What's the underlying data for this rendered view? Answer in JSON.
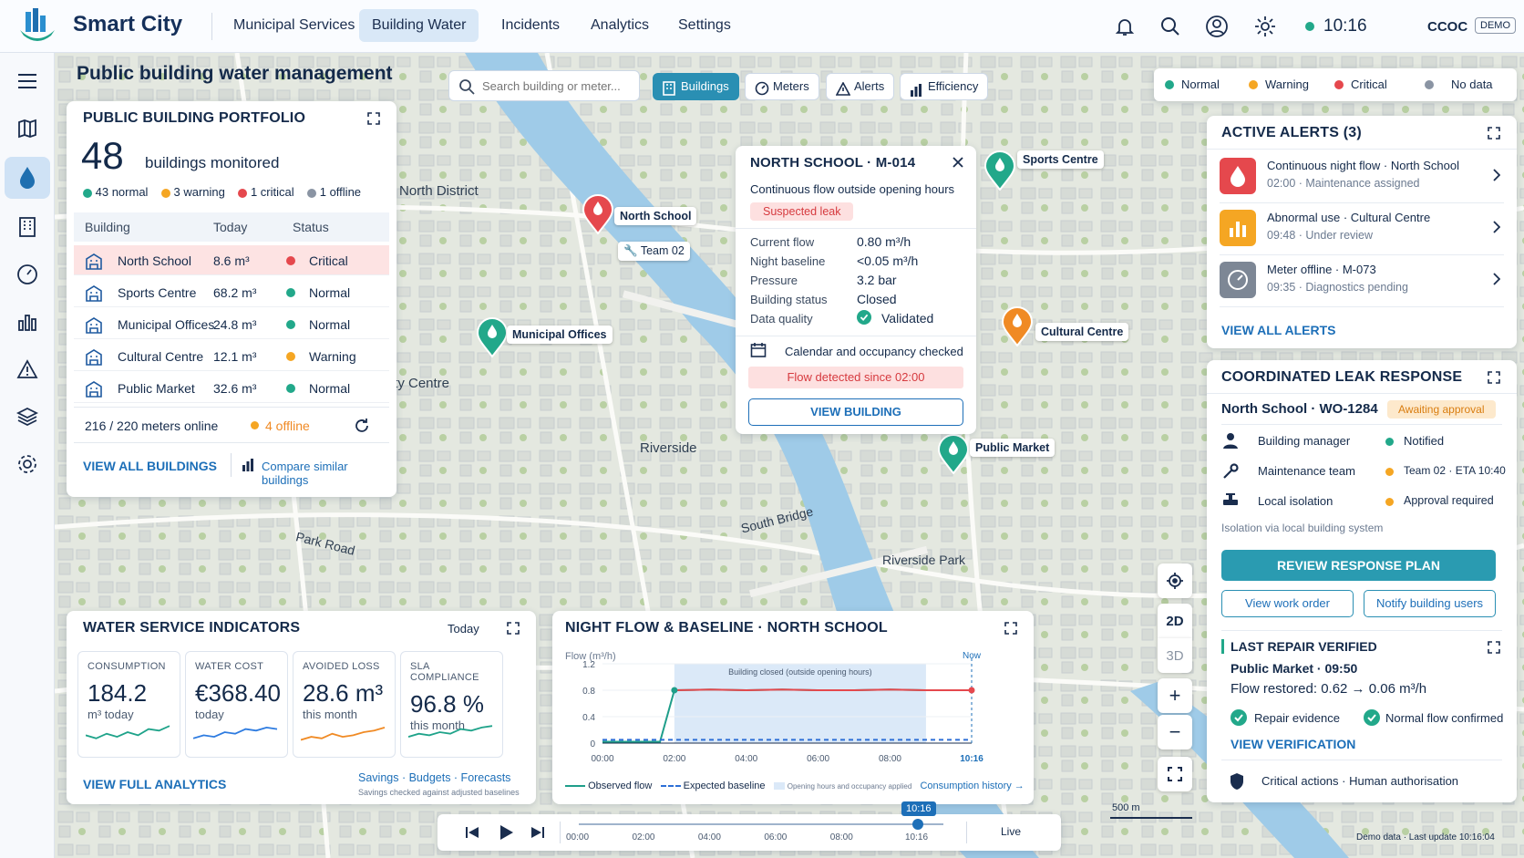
{
  "app": {
    "name": "Smart City",
    "user": "CCOC",
    "env": "DEMO",
    "time": "10:16"
  },
  "nav": [
    {
      "label": "Municipal Services"
    },
    {
      "label": "Building Water"
    },
    {
      "label": "Incidents"
    },
    {
      "label": "Analytics"
    },
    {
      "label": "Settings"
    }
  ],
  "page": {
    "title": "Public building water management"
  },
  "search": {
    "placeholder": "Search building or meter..."
  },
  "filters": [
    {
      "label": "Buildings"
    },
    {
      "label": "Meters"
    },
    {
      "label": "Alerts"
    },
    {
      "label": "Efficiency"
    }
  ],
  "legend": [
    {
      "label": "Normal",
      "color": "#22a88a"
    },
    {
      "label": "Warning",
      "color": "#f5a623"
    },
    {
      "label": "Critical",
      "color": "#e5484d"
    },
    {
      "label": "No data",
      "color": "#8a94a3"
    }
  ],
  "portfolio": {
    "title": "PUBLIC BUILDING PORTFOLIO",
    "count": "48",
    "count_label": "buildings monitored",
    "summary": [
      {
        "label": "43 normal",
        "color": "#22a88a"
      },
      {
        "label": "3 warning",
        "color": "#f5a623"
      },
      {
        "label": "1 critical",
        "color": "#e5484d"
      },
      {
        "label": "1 offline",
        "color": "#8a94a3"
      }
    ],
    "headers": [
      "Building",
      "Today",
      "Status"
    ],
    "rows": [
      {
        "name": "North School",
        "today": "8.6 m³",
        "status": "Critical",
        "color": "#e5484d",
        "icon": "school-icon"
      },
      {
        "name": "Sports Centre",
        "today": "68.2 m³",
        "status": "Normal",
        "color": "#22a88a",
        "icon": "pool-icon"
      },
      {
        "name": "Municipal Offices",
        "today": "24.8 m³",
        "status": "Normal",
        "color": "#22a88a",
        "icon": "office-icon"
      },
      {
        "name": "Cultural Centre",
        "today": "12.1 m³",
        "status": "Warning",
        "color": "#f5a623",
        "icon": "museum-icon"
      },
      {
        "name": "Public Market",
        "today": "32.6 m³",
        "status": "Normal",
        "color": "#22a88a",
        "icon": "market-icon"
      }
    ],
    "meters_online": "216 / 220 meters online",
    "offline": "4 offline",
    "view_all": "VIEW ALL BUILDINGS",
    "compare": "Compare similar buildings"
  },
  "map_labels": {
    "north_district": "North District",
    "city_centre": "City Centre",
    "riverside": "Riverside",
    "south_bridge": "South Bridge",
    "park_road": "Park Road",
    "riverside_park": "Riverside Park",
    "team": "Team 02",
    "scale": "500 m"
  },
  "pins": {
    "north_school": "North School",
    "municipal_offices": "Municipal Offices",
    "sports_centre": "Sports Centre",
    "cultural_centre": "Cultural Centre",
    "public_market": "Public Market"
  },
  "popup": {
    "title": "NORTH SCHOOL · M-014",
    "subtitle": "Continuous flow outside opening hours",
    "tag": "Suspected leak",
    "fields": [
      {
        "k": "Current flow",
        "v": "0.80 m³/h"
      },
      {
        "k": "Night baseline",
        "v": "<0.05 m³/h"
      },
      {
        "k": "Pressure",
        "v": "3.2 bar"
      },
      {
        "k": "Building status",
        "v": "Closed"
      },
      {
        "k": "Data quality",
        "v": "Validated"
      }
    ],
    "calendar": "Calendar and occupancy checked",
    "banner": "Flow detected since 02:00",
    "button": "VIEW BUILDING"
  },
  "alerts": {
    "title": "ACTIVE ALERTS (3)",
    "items": [
      {
        "title": "Continuous night flow · North School",
        "meta": "02:00 · Maintenance assigned",
        "color": "#e5484d"
      },
      {
        "title": "Abnormal use · Cultural Centre",
        "meta": "09:48 · Under review",
        "color": "#f5a623"
      },
      {
        "title": "Meter offline · M-073",
        "meta": "09:35 · Diagnostics pending",
        "color": "#7d8795"
      }
    ],
    "view_all": "VIEW ALL ALERTS"
  },
  "response": {
    "title": "COORDINATED LEAK RESPONSE",
    "order": "North School · WO-1284",
    "badge": "Awaiting approval",
    "items": [
      {
        "role": "Building manager",
        "status": "Notified",
        "color": "#22a88a"
      },
      {
        "role": "Maintenance team",
        "status": "Team 02 · ETA 10:40",
        "color": "#f5a623"
      },
      {
        "role": "Local isolation",
        "status": "Approval required",
        "color": "#f5a623"
      }
    ],
    "note": "Isolation via local building system",
    "primary": "REVIEW RESPONSE PLAN",
    "secondary": [
      "View work order",
      "Notify building users"
    ]
  },
  "repair": {
    "title": "LAST REPAIR VERIFIED",
    "subtitle": "Public Market · 09:50",
    "flow": "Flow restored: 0.62 → 0.06 m³/h",
    "checks": [
      "Repair evidence",
      "Normal flow confirmed"
    ],
    "link": "VIEW VERIFICATION",
    "footer": "Critical actions · Human authorisation"
  },
  "indicators": {
    "title": "WATER SERVICE INDICATORS",
    "period": "Today",
    "kpis": [
      {
        "cap": "CONSUMPTION",
        "val": "184.2",
        "sub": "m³ today",
        "color": "#1fa38a"
      },
      {
        "cap": "WATER COST",
        "val": "€368.40",
        "sub": "today",
        "color": "#2d7be0"
      },
      {
        "cap": "AVOIDED LOSS",
        "val": "28.6 m³",
        "sub": "this month",
        "color": "#f08a24"
      },
      {
        "cap": "SLA COMPLIANCE",
        "val": "96.8 %",
        "sub": "this month",
        "color": "#1fa38a"
      }
    ],
    "view": "VIEW FULL ANALYTICS",
    "links": "Savings · Budgets · Forecasts",
    "note": "Savings checked against adjusted baselines"
  },
  "chart_data": {
    "type": "line",
    "title": "NIGHT FLOW & BASELINE · NORTH SCHOOL",
    "ylabel": "Flow (m³/h)",
    "x": [
      "00:00",
      "02:00",
      "04:00",
      "06:00",
      "08:00",
      "10:16"
    ],
    "ylim": [
      0,
      1.2
    ],
    "yticks": [
      "1.2",
      "0.8",
      "0.4",
      "0"
    ],
    "series": [
      {
        "name": "Observed flow",
        "color": "#1f9e8a",
        "points": [
          [
            0,
            0.02
          ],
          [
            1.6,
            0.02
          ],
          [
            2,
            0.8
          ],
          [
            3,
            0.81
          ],
          [
            4,
            0.8
          ],
          [
            5,
            0.81
          ],
          [
            6,
            0.8
          ],
          [
            7,
            0.8
          ],
          [
            8,
            0.81
          ],
          [
            9,
            0.8
          ],
          [
            10.27,
            0.8
          ]
        ]
      },
      {
        "name": "Expected baseline",
        "color": "#2d6fd6",
        "points": [
          [
            0,
            0.05
          ],
          [
            10.27,
            0.05
          ]
        ]
      }
    ],
    "band": {
      "from": 2,
      "to": 9,
      "label": "Building closed (outside opening hours)"
    },
    "now_label": "Now",
    "legend": [
      "Observed flow",
      "Expected baseline",
      "Opening hours and occupancy applied"
    ],
    "history": "Consumption history →"
  },
  "timeline": {
    "ticks": [
      "00:00",
      "02:00",
      "04:00",
      "06:00",
      "08:00",
      "10:16"
    ],
    "current": "10:16",
    "live": "Live",
    "position": 0.93
  },
  "map_controls": {
    "mode2d": "2D",
    "mode3d": "3D",
    "zoom_in": "+",
    "zoom_out": "−"
  },
  "footer": {
    "demo": "Demo data · Last update 10:16:04"
  }
}
